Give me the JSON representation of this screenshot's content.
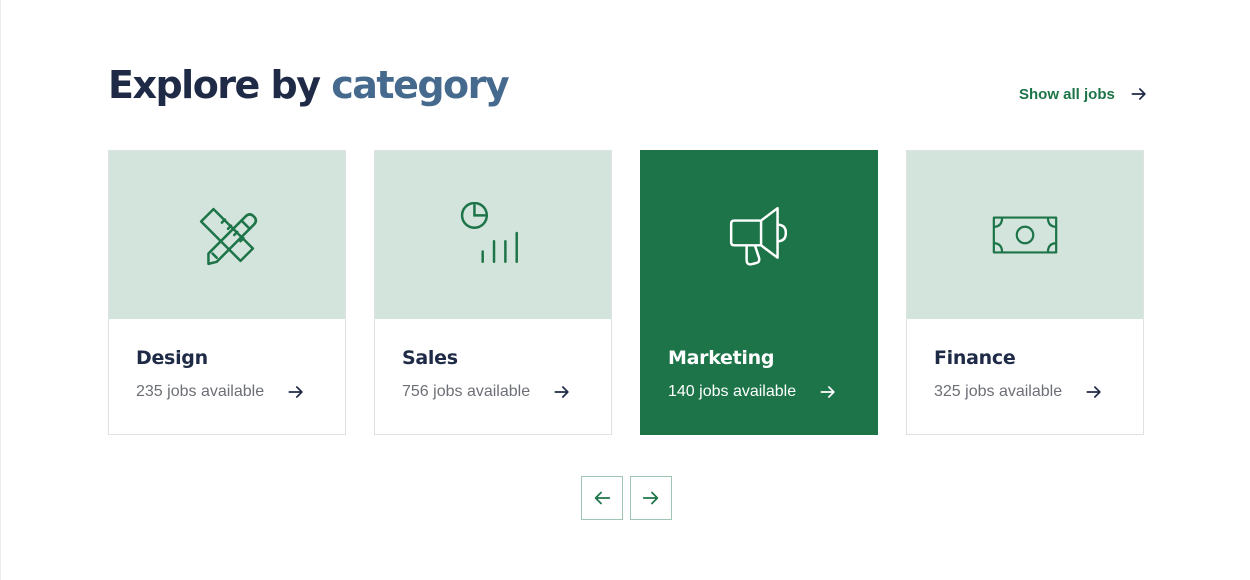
{
  "header": {
    "title_prefix": "Explore by",
    "title_accent": "category",
    "show_all_label": "Show all jobs"
  },
  "categories": [
    {
      "name": "Design",
      "count_text": "235 jobs available",
      "icon": "pencil-ruler-icon",
      "active": false
    },
    {
      "name": "Sales",
      "count_text": "756 jobs available",
      "icon": "pie-chart-bars-icon",
      "active": false
    },
    {
      "name": "Marketing",
      "count_text": "140 jobs available",
      "icon": "megaphone-icon",
      "active": true
    },
    {
      "name": "Finance",
      "count_text": "325 jobs available",
      "icon": "banknote-icon",
      "active": false
    }
  ],
  "pagination": {
    "prev_icon": "arrow-left-icon",
    "next_icon": "arrow-right-icon"
  },
  "colors": {
    "brand_green": "#1c7448",
    "tile_bg": "#d3e4dd",
    "heading_dark": "#1e2a46",
    "heading_accent": "#456a8e",
    "muted_text": "#6c6f75"
  }
}
